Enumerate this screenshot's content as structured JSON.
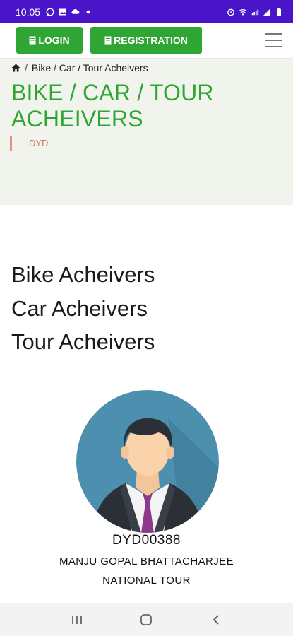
{
  "status_bar": {
    "time": "10:05",
    "left_icons": [
      "whatsapp-icon",
      "image-icon",
      "cloud-icon",
      "dot-icon"
    ],
    "right_icons": [
      "alarm-icon",
      "wifi-icon",
      "lte-signal-icon",
      "signal-icon",
      "battery-icon"
    ]
  },
  "header": {
    "login_label": "LOGIN",
    "registration_label": "REGISTRATION",
    "menu_icon": "hamburger-icon"
  },
  "breadcrumb": {
    "separator": "/",
    "current": "Bike / Car / Tour Acheivers"
  },
  "page": {
    "title": "BIKE / CAR / TOUR ACHEIVERS",
    "subtitle": "DYD"
  },
  "categories": [
    "Bike Acheivers",
    "Car Acheivers",
    "Tour Acheivers"
  ],
  "achiever": {
    "id": "DYD00388",
    "name": "MANJU GOPAL BHATTACHARJEE",
    "award": "NATIONAL TOUR"
  },
  "colors": {
    "status_bar": "#4a14c8",
    "brand_green": "#2fa534",
    "subtitle_accent": "#d9725f",
    "title_bg": "#f1f4ec"
  },
  "nav_bar": [
    "recent-apps-icon",
    "home-icon",
    "back-icon"
  ]
}
